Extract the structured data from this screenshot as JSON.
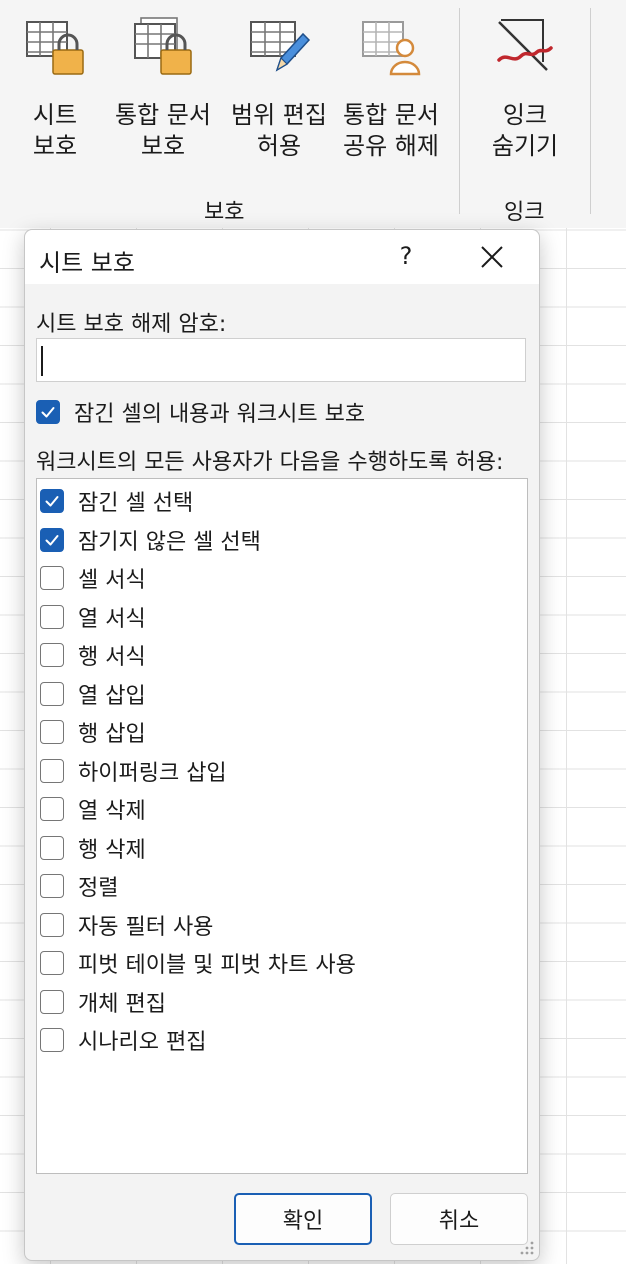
{
  "ribbon": {
    "protect_group": {
      "label": "보호",
      "buttons": [
        {
          "label": "시트\n보호",
          "icon": "sheet-lock-icon"
        },
        {
          "label": "통합 문서\n보호",
          "icon": "workbook-lock-icon"
        },
        {
          "label": "범위 편집\n허용",
          "icon": "grid-pencil-icon"
        },
        {
          "label": "통합 문서\n공유 해제",
          "icon": "workbook-user-icon"
        }
      ]
    },
    "ink_group": {
      "label": "잉크",
      "buttons": [
        {
          "label": "잉크\n숨기기",
          "icon": "ink-hide-icon"
        }
      ]
    }
  },
  "dialog": {
    "title": "시트 보호",
    "help": "?",
    "password_label": "시트 보호 해제 암호:",
    "password_value": "",
    "protect_checkbox": {
      "label": "잠긴 셀의 내용과 워크시트 보호",
      "checked": true
    },
    "allow_label": "워크시트의 모든 사용자가 다음을 수행하도록 허용:",
    "options": [
      {
        "label": "잠긴 셀 선택",
        "checked": true
      },
      {
        "label": "잠기지 않은 셀 선택",
        "checked": true
      },
      {
        "label": "셀 서식",
        "checked": false
      },
      {
        "label": "열 서식",
        "checked": false
      },
      {
        "label": "행 서식",
        "checked": false
      },
      {
        "label": "열 삽입",
        "checked": false
      },
      {
        "label": "행 삽입",
        "checked": false
      },
      {
        "label": "하이퍼링크 삽입",
        "checked": false
      },
      {
        "label": "열 삭제",
        "checked": false
      },
      {
        "label": "행 삭제",
        "checked": false
      },
      {
        "label": "정렬",
        "checked": false
      },
      {
        "label": "자동 필터 사용",
        "checked": false
      },
      {
        "label": "피벗 테이블 및 피벗 차트 사용",
        "checked": false
      },
      {
        "label": "개체 편집",
        "checked": false
      },
      {
        "label": "시나리오 편집",
        "checked": false
      }
    ],
    "ok_label": "확인",
    "cancel_label": "취소"
  },
  "colors": {
    "accent": "#1a5fb4",
    "lock": "#f0b24a",
    "ink": "#c0272d"
  }
}
